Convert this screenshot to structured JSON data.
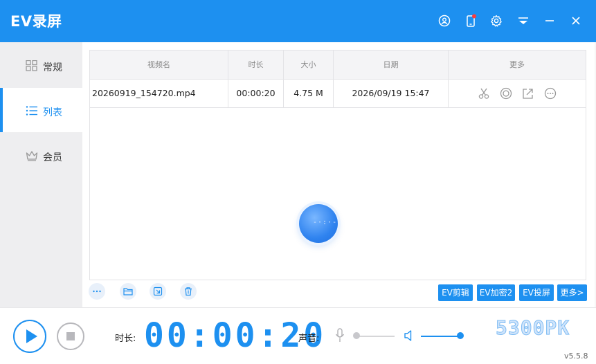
{
  "app": {
    "title": "EV录屏"
  },
  "titlebar": {
    "icons": [
      "user-icon",
      "phone-notify-icon",
      "gear-icon",
      "menu-icon",
      "minimize-icon",
      "close-icon"
    ],
    "accent": "#1d90f0"
  },
  "sidebar": {
    "items": [
      {
        "label": "常规",
        "icon": "grid-icon",
        "active": false
      },
      {
        "label": "列表",
        "icon": "list-icon",
        "active": true
      },
      {
        "label": "会员",
        "icon": "crown-icon",
        "active": false
      }
    ]
  },
  "table": {
    "columns": [
      "视频名",
      "时长",
      "大小",
      "日期",
      "更多"
    ],
    "rows": [
      {
        "name": "20260919_154720.mp4",
        "duration": "00:00:20",
        "size": "4.75 M",
        "date": "2026/09/19 15:47",
        "actions": [
          "scissors-icon",
          "circle-icon",
          "share-icon",
          "more-icon"
        ]
      }
    ]
  },
  "tools": {
    "icons": [
      "more-dots-icon",
      "folder-icon",
      "import-icon",
      "trash-icon"
    ],
    "buttons": [
      "EV剪辑",
      "EV加密2",
      "EV投屏",
      "更多>"
    ]
  },
  "footer": {
    "duration_label": "时长:",
    "timer": "00:00:20",
    "sound_label": "声音:",
    "mic_level": 0.0,
    "speaker_level": 1.0,
    "watermark": "5300PK",
    "version": "v5.5.8"
  }
}
